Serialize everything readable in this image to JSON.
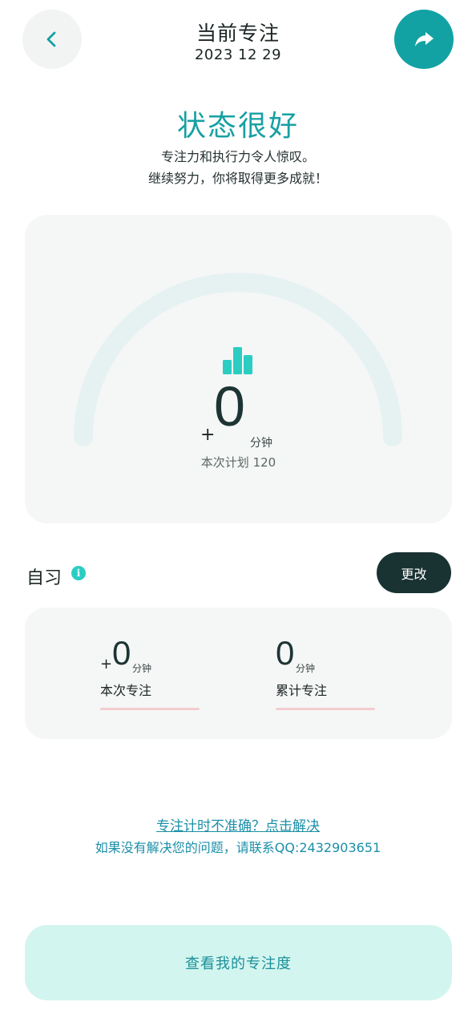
{
  "header": {
    "title": "当前专注",
    "date": "2023 12 29"
  },
  "status": {
    "title": "状态很好",
    "line1": "专注力和执行力令人惊叹。",
    "line2": "继续努力，你将取得更多成就！"
  },
  "gauge": {
    "prefix": "+",
    "value": "0",
    "unit": "分钟",
    "plan": "本次计划 120",
    "progress": 0,
    "track_color": "#e6f2f2",
    "icon_color": "#2bcdc2"
  },
  "section": {
    "label": "自习",
    "info_icon": "info-icon",
    "change_label": "更改"
  },
  "stats": [
    {
      "prefix": "+",
      "value": "0",
      "unit": "分钟",
      "label": "本次专注"
    },
    {
      "prefix": "",
      "value": "0",
      "unit": "分钟",
      "label": "累计专注"
    }
  ],
  "help": {
    "link": "专注计时不准确？点击解决",
    "contact": "如果没有解决您的问题，请联系QQ:2432903651"
  },
  "bottom": {
    "button_label": "查看我的专注度"
  },
  "colors": {
    "accent": "#12a2a4",
    "dark": "#193232",
    "link": "#1b8fa8",
    "bottom_bg": "#d3f5ef"
  }
}
